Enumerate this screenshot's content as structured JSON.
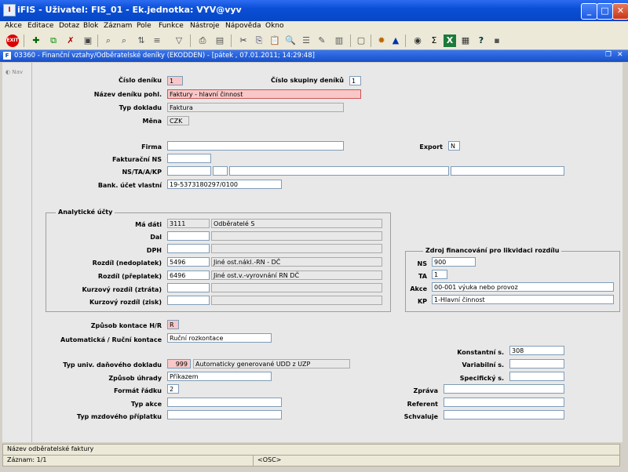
{
  "window": {
    "title": "iFIS - Uživatel: FIS_01 - Ek.jednotka: VYV@vyv",
    "app_icon": "I"
  },
  "menu": [
    "Akce",
    "Editace",
    "Dotaz",
    "Blok",
    "Záznam",
    "Pole",
    "Funkce",
    "Nástroje",
    "Nápověda",
    "Okno"
  ],
  "child": {
    "title": "03360 - Finanční vztahy/Odběratelské deníky (EKODDEN) - [pátek , 07.01.2011; 14:29:48]"
  },
  "nav_label": "Nav",
  "form": {
    "cislo_deniku": {
      "label": "Číslo deníku",
      "value": "1"
    },
    "cislo_skupiny": {
      "label": "Číslo skupiny deníků",
      "value": "1"
    },
    "nazev_deniku": {
      "label": "Název deníku pohl.",
      "value": "Faktury - hlavní činnost"
    },
    "typ_dokladu": {
      "label": "Typ dokladu",
      "value": "Faktura"
    },
    "mena": {
      "label": "Měna",
      "value": "CZK"
    },
    "firma": {
      "label": "Firma",
      "value": ""
    },
    "export": {
      "label": "Export",
      "value": "N"
    },
    "fakturacni_ns": {
      "label": "Fakturační NS",
      "value": ""
    },
    "ns_ta_a_kp": {
      "label": "NS/TA/A/KP",
      "value": ""
    },
    "bank_ucet": {
      "label": "Bank. účet vlastní",
      "value": "19-5373180297/0100"
    },
    "analyticke": {
      "title": "Analytické účty",
      "rows": [
        {
          "label": "Má dáti",
          "code": "3111",
          "desc": "Odběratelé                    S"
        },
        {
          "label": "Dal",
          "code": "",
          "desc": ""
        },
        {
          "label": "DPH",
          "code": "",
          "desc": ""
        },
        {
          "label": "Rozdíl (nedoplatek)",
          "code": "5496",
          "desc": "Jiné ost.nákl.-RN - DČ"
        },
        {
          "label": "Rozdíl (přeplatek)",
          "code": "6496",
          "desc": "Jiné ost.v.-vyrovnání RN DČ"
        },
        {
          "label": "Kurzový rozdíl (ztráta)",
          "code": "",
          "desc": ""
        },
        {
          "label": "Kurzový rozdíl (zisk)",
          "code": "",
          "desc": ""
        }
      ]
    },
    "zdroj": {
      "title": "Zdroj financování pro likvidaci rozdílu",
      "ns": {
        "label": "NS",
        "value": "900"
      },
      "ta": {
        "label": "TA",
        "value": "1"
      },
      "akce": {
        "label": "Akce",
        "value": "00-001 výuka nebo provoz"
      },
      "kp": {
        "label": "KP",
        "value": "1-Hlavní činnost"
      }
    },
    "zpusob_kontace": {
      "label": "Způsob kontace H/R",
      "value": "R"
    },
    "auto_rucni": {
      "label": "Automatická / Ruční kontace",
      "value": "Ruční rozkontace"
    },
    "konstantni": {
      "label": "Konstantní s.",
      "value": "308"
    },
    "typ_univ": {
      "label": "Typ univ. daňového dokladu",
      "code": "999",
      "desc": "Automaticky generované UDD z UZP"
    },
    "variabilni": {
      "label": "Variabilní s.",
      "value": ""
    },
    "zpusob_uhrady": {
      "label": "Způsob úhrady",
      "value": "Příkazem"
    },
    "specificky": {
      "label": "Specifický s.",
      "value": ""
    },
    "format_radku": {
      "label": "Formát řádku",
      "value": "2"
    },
    "zprava": {
      "label": "Zpráva",
      "value": ""
    },
    "typ_akce": {
      "label": "Typ akce",
      "value": ""
    },
    "referent": {
      "label": "Referent",
      "value": ""
    },
    "typ_mzdoveho": {
      "label": "Typ mzdového příplatku",
      "value": ""
    },
    "schvaluje": {
      "label": "Schvaluje",
      "value": ""
    }
  },
  "status": {
    "hint": "Název odběratelské faktury",
    "record": "Záznam: 1/1",
    "osc": "<OSC>"
  }
}
